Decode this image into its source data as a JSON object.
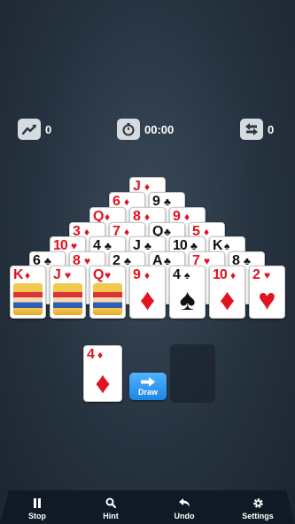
{
  "stats": {
    "score": "0",
    "time": "00:00",
    "moves": "0"
  },
  "pyramid_rows": [
    [
      {
        "rank": "J",
        "suit": "♦",
        "color": "red"
      }
    ],
    [
      {
        "rank": "6",
        "suit": "♦",
        "color": "red"
      },
      {
        "rank": "9",
        "suit": "♣",
        "color": "black"
      }
    ],
    [
      {
        "rank": "Q",
        "suit": "♦",
        "color": "red"
      },
      {
        "rank": "8",
        "suit": "♦",
        "color": "red"
      },
      {
        "rank": "9",
        "suit": "♦",
        "color": "red"
      }
    ],
    [
      {
        "rank": "3",
        "suit": "♦",
        "color": "red"
      },
      {
        "rank": "7",
        "suit": "♦",
        "color": "red"
      },
      {
        "rank": "Q",
        "suit": "♣",
        "color": "black"
      },
      {
        "rank": "5",
        "suit": "♦",
        "color": "red"
      }
    ],
    [
      {
        "rank": "10",
        "suit": "♥",
        "color": "red"
      },
      {
        "rank": "4",
        "suit": "♣",
        "color": "black"
      },
      {
        "rank": "J",
        "suit": "♣",
        "color": "black"
      },
      {
        "rank": "10",
        "suit": "♣",
        "color": "black"
      },
      {
        "rank": "K",
        "suit": "♠",
        "color": "black"
      }
    ],
    [
      {
        "rank": "6",
        "suit": "♣",
        "color": "black"
      },
      {
        "rank": "8",
        "suit": "♥",
        "color": "red"
      },
      {
        "rank": "2",
        "suit": "♣",
        "color": "black"
      },
      {
        "rank": "A",
        "suit": "♣",
        "color": "black"
      },
      {
        "rank": "7",
        "suit": "♥",
        "color": "red"
      },
      {
        "rank": "8",
        "suit": "♣",
        "color": "black"
      }
    ],
    [
      {
        "rank": "K",
        "suit": "♦",
        "color": "red",
        "face": true
      },
      {
        "rank": "J",
        "suit": "♥",
        "color": "red",
        "face": true
      },
      {
        "rank": "Q",
        "suit": "♥",
        "color": "red",
        "face": true
      },
      {
        "rank": "9",
        "suit": "♦",
        "color": "red"
      },
      {
        "rank": "4",
        "suit": "♠",
        "color": "black"
      },
      {
        "rank": "10",
        "suit": "♦",
        "color": "red"
      },
      {
        "rank": "2",
        "suit": "♥",
        "color": "red"
      }
    ]
  ],
  "waste_card": {
    "rank": "4",
    "suit": "♦",
    "color": "red"
  },
  "draw_button": {
    "label": "Draw"
  },
  "nav": {
    "stop": "Stop",
    "hint": "Hint",
    "undo": "Undo",
    "settings": "Settings"
  }
}
